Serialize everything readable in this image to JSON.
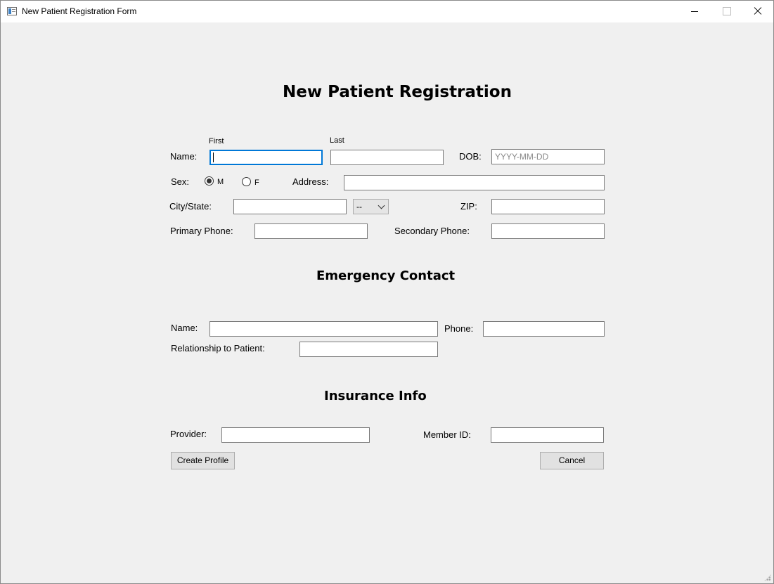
{
  "window": {
    "title": "New Patient Registration Form",
    "icon": "app-window-icon",
    "controls": {
      "minimize": "minimize-icon",
      "maximize": "maximize-icon",
      "close": "close-icon"
    }
  },
  "form": {
    "heading": "New Patient Registration",
    "patient": {
      "name_label": "Name:",
      "first_caption": "First",
      "last_caption": "Last",
      "first_value": "",
      "last_value": "",
      "dob_label": "DOB:",
      "dob_placeholder": "YYYY-MM-DD",
      "sex_label": "Sex:",
      "sex_options": [
        "M",
        "F"
      ],
      "sex_selected": "M",
      "address_label": "Address:",
      "address_value": "",
      "city_state_label": "City/State:",
      "city_value": "",
      "state_selected": "--",
      "zip_label": "ZIP:",
      "zip_value": "",
      "primary_phone_label": "Primary Phone:",
      "primary_phone_value": "",
      "secondary_phone_label": "Secondary Phone:",
      "secondary_phone_value": ""
    },
    "emergency": {
      "heading": "Emergency Contact",
      "name_label": "Name:",
      "name_value": "",
      "phone_label": "Phone:",
      "phone_value": "",
      "relationship_label": "Relationship to Patient:",
      "relationship_value": ""
    },
    "insurance": {
      "heading": "Insurance Info",
      "provider_label": "Provider:",
      "provider_value": "",
      "member_id_label": "Member ID:",
      "member_id_value": ""
    },
    "buttons": {
      "create": "Create Profile",
      "cancel": "Cancel"
    }
  }
}
